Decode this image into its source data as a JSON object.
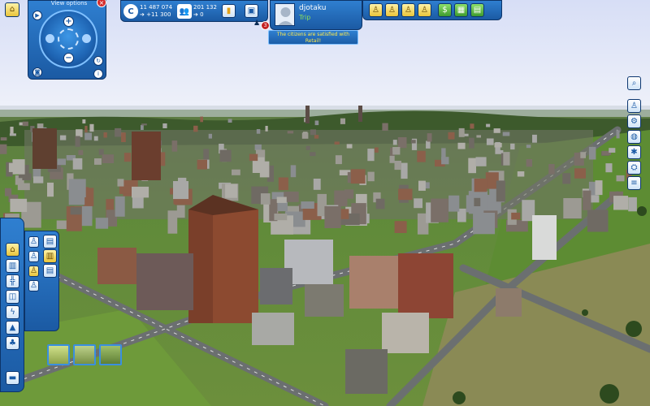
{
  "view_panel": {
    "title": "View options",
    "close_label": "×",
    "zoom_in": "+",
    "zoom_out": "−"
  },
  "stats": {
    "population": "11 487 074",
    "population_delta": "➔ +11 300",
    "jobs": "201 132",
    "jobs_delta": "➔ 0"
  },
  "profile": {
    "username": "djotaku",
    "rank": "Trip",
    "notification_count": "3",
    "tooltip": "The citizens are satisfied with Retail!"
  },
  "top_tools": {
    "yellow_icons": [
      "people-icon",
      "people-icon",
      "people-icon",
      "people-icon"
    ],
    "green_icons": [
      "dollar-icon",
      "map-icon",
      "chart-icon"
    ]
  },
  "right_tools": {
    "icons": [
      "magnifier-icon",
      "people-icon",
      "gear-icon",
      "globe-icon",
      "star-icon",
      "crane-icon",
      "list-icon"
    ]
  },
  "left_tools": {
    "icons": [
      "home-icon",
      "factory-icon",
      "road-icon",
      "pipe-icon",
      "power-icon",
      "school-icon",
      "park-icon",
      "list-icon",
      "save-icon"
    ],
    "sub_icons": [
      "people-icon",
      "building-icon",
      "people-icon",
      "shop-icon",
      "people-icon",
      "building-icon",
      "people-icon"
    ]
  },
  "colors": {
    "hud_blue": "#1f66b5",
    "accent_yellow": "#ffe94a",
    "rank_green": "#8ce05a"
  }
}
